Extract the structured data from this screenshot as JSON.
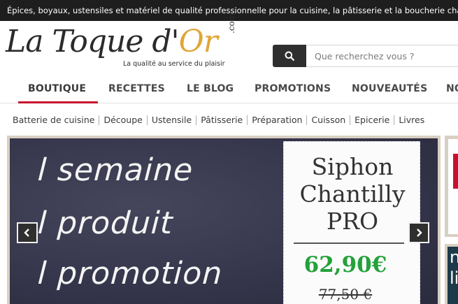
{
  "topbar": {
    "text": "Épices, boyaux, ustensiles et matériel de qualité professionnelle pour la cuisine, la pâtisserie et la boucherie charcuterie"
  },
  "logo": {
    "main_prefix": "La Toque d'",
    "main_or": "Or",
    "com": ".com",
    "tagline": "La qualité au  service du plaisir"
  },
  "search": {
    "placeholder": "Que recherchez vous ?",
    "icon": "search-icon"
  },
  "main_nav": [
    {
      "label": "BOUTIQUE",
      "active": true
    },
    {
      "label": "RECETTES"
    },
    {
      "label": "LE BLOG"
    },
    {
      "label": "PROMOTIONS"
    },
    {
      "label": "NOUVEAUTÉS"
    },
    {
      "label": "NO"
    }
  ],
  "sub_nav": [
    "Batterie de cuisine",
    "Découpe",
    "Ustensile",
    "Pâtisserie",
    "Préparation",
    "Cuisson",
    "Epicerie",
    "Livres"
  ],
  "banner": {
    "lines": [
      "l semaine",
      "l produit",
      "l promotion"
    ],
    "card": {
      "title_lines": [
        "Siphon",
        "Chantilly",
        "PRO"
      ],
      "price": "62,90€",
      "old_price": "77,50 €"
    },
    "prev_icon": "chevron-left-icon",
    "next_icon": "chevron-right-icon"
  },
  "side": {
    "bottom_text": "n\nli"
  },
  "colors": {
    "accent_red": "#c8102e",
    "price_green": "#24a13a",
    "logo_gold": "#e0a63a",
    "topbar_bg": "#1e1e1e"
  }
}
